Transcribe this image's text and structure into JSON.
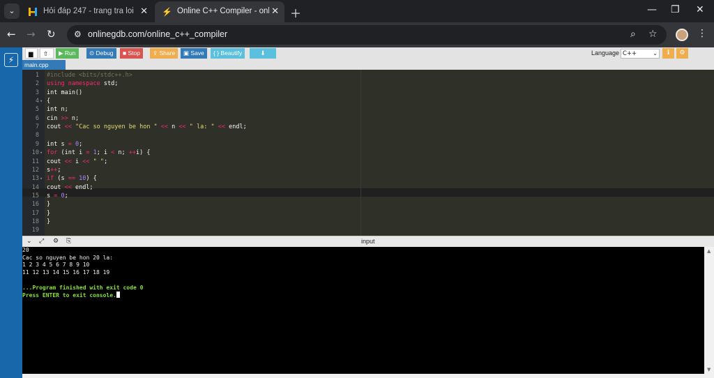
{
  "browser": {
    "tabs": [
      {
        "title": "Hỏi đáp 247 - trang tra loi",
        "favicon": "H",
        "active": false
      },
      {
        "title": "Online C++ Compiler - online editor",
        "favicon": "⚡",
        "active": true
      }
    ],
    "url": "onlinegdb.com/online_c++_compiler"
  },
  "ide": {
    "toolbar": {
      "run": "Run",
      "debug": "Debug",
      "stop": "Stop",
      "share": "Share",
      "save": "Save",
      "beautify": "{ } Beautify",
      "language_label": "Language",
      "language_value": "C++"
    },
    "file_tab": "main.cpp",
    "console_header": "input",
    "code_lines": [
      {
        "n": "1",
        "html": "<span class=\"p\">#include &lt;bits/stdc++.h&gt;</span>"
      },
      {
        "n": "2",
        "html": "<span class=\"k\">using namespace</span> std;"
      },
      {
        "n": "3",
        "html": "int main()"
      },
      {
        "n": "4",
        "html": "{",
        "fold": true
      },
      {
        "n": "5",
        "html": "int n;"
      },
      {
        "n": "6",
        "html": "cin <span class=\"k\">&gt;&gt;</span> n;"
      },
      {
        "n": "7",
        "html": "cout <span class=\"k\">&lt;&lt;</span> <span class=\"s\">\"Cac so nguyen be hon \"</span> <span class=\"k\">&lt;&lt;</span> n <span class=\"k\">&lt;&lt;</span> <span class=\"s\">\" la: \"</span> <span class=\"k\">&lt;&lt;</span> endl;"
      },
      {
        "n": "8",
        "html": ""
      },
      {
        "n": "9",
        "html": "int s <span class=\"k\">=</span> <span class=\"n\">0</span>;"
      },
      {
        "n": "10",
        "html": "<span class=\"k\">for</span> (int i <span class=\"k\">=</span> <span class=\"n\">1</span>; i <span class=\"k\">&lt;</span> n; <span class=\"k\">++</span>i) {",
        "fold": true
      },
      {
        "n": "11",
        "html": "cout <span class=\"k\">&lt;&lt;</span> i <span class=\"k\">&lt;&lt;</span> <span class=\"s\">\" \"</span>;"
      },
      {
        "n": "12",
        "html": "s<span class=\"k\">++</span>;"
      },
      {
        "n": "13",
        "html": "<span class=\"k\">if</span> (s <span class=\"k\">==</span> <span class=\"n\">10</span>) {",
        "fold": true
      },
      {
        "n": "14",
        "html": "cout <span class=\"k\">&lt;&lt;</span> endl;"
      },
      {
        "n": "15",
        "html": "s <span class=\"k\">=</span> <span class=\"n\">0</span>;",
        "active": true
      },
      {
        "n": "16",
        "html": "}"
      },
      {
        "n": "17",
        "html": "}"
      },
      {
        "n": "18",
        "html": "}"
      },
      {
        "n": "19",
        "html": ""
      }
    ],
    "console_lines": [
      {
        "text": "20",
        "green": false
      },
      {
        "text": "Cac so nguyen be hon 20 la:",
        "green": false
      },
      {
        "text": "1 2 3 4 5 6 7 8 9 10",
        "green": false
      },
      {
        "text": "11 12 13 14 15 16 17 18 19",
        "green": false
      },
      {
        "text": "",
        "green": false
      },
      {
        "text": "...Program finished with exit code 0",
        "green": true
      },
      {
        "text": "Press ENTER to exit console.",
        "green": true,
        "cursor": true
      }
    ]
  },
  "colors": {
    "sidebar": "#1767aa",
    "editor_bg": "#2f3129",
    "console_bg": "#000000",
    "run": "#5cb85c",
    "stop": "#d9534f",
    "share": "#f0ad4e"
  }
}
